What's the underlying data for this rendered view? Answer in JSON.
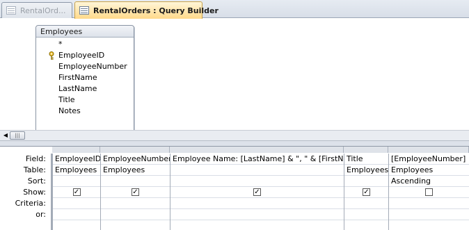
{
  "tabs": [
    {
      "label": "RentalOrd...",
      "active": false,
      "icon": "table-icon"
    },
    {
      "label": "RentalOrders : Query Builder",
      "active": true,
      "icon": "query-icon"
    }
  ],
  "field_list": {
    "title": "Employees",
    "fields": [
      "*",
      "EmployeeID",
      "EmployeeNumber",
      "FirstName",
      "LastName",
      "Title",
      "Notes"
    ],
    "primary_key": "EmployeeID"
  },
  "grid": {
    "row_labels": [
      "Field:",
      "Table:",
      "Sort:",
      "Show:",
      "Criteria:",
      "or:"
    ],
    "columns": [
      {
        "field": "EmployeeID",
        "table": "Employees",
        "sort": "",
        "show": true
      },
      {
        "field": "EmployeeNumber",
        "table": "Employees",
        "sort": "",
        "show": true
      },
      {
        "field": "Employee Name: [LastName] & \", \" & [FirstName]",
        "table": "",
        "sort": "",
        "show": true
      },
      {
        "field": "Title",
        "table": "Employees",
        "sort": "",
        "show": true
      },
      {
        "field": "[EmployeeNumber]",
        "table": "Employees",
        "sort": "Ascending",
        "show": false
      }
    ]
  },
  "colors": {
    "active_tab": "#ffd98a",
    "background": "#ffffff"
  }
}
